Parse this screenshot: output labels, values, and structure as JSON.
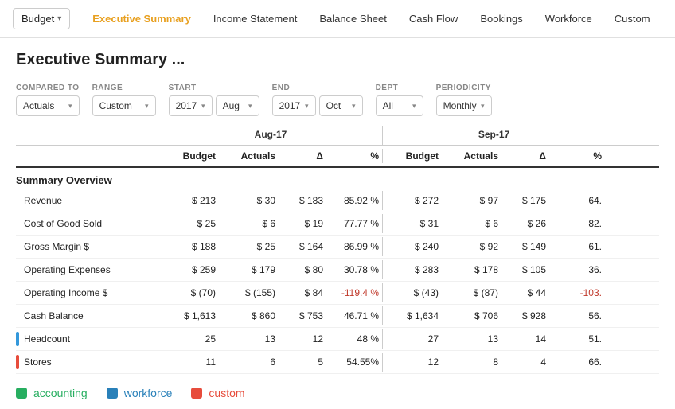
{
  "nav": {
    "dropdown_label": "Budget",
    "items": [
      {
        "label": "Executive Summary",
        "active": true
      },
      {
        "label": "Income Statement",
        "active": false
      },
      {
        "label": "Balance Sheet",
        "active": false
      },
      {
        "label": "Cash Flow",
        "active": false
      },
      {
        "label": "Bookings",
        "active": false
      },
      {
        "label": "Workforce",
        "active": false
      },
      {
        "label": "Custom",
        "active": false
      }
    ]
  },
  "page": {
    "title": "Executive Summary ..."
  },
  "filters": {
    "compared_to": {
      "label": "COMPARED TO",
      "value": "Actuals"
    },
    "range": {
      "label": "RANGE",
      "value": "Custom"
    },
    "start_year": {
      "label": "START",
      "value": "2017"
    },
    "start_month": {
      "value": "Aug"
    },
    "end_year": {
      "label": "END",
      "value": "2017"
    },
    "end_month": {
      "value": "Oct"
    },
    "dept": {
      "label": "DEPT",
      "value": "All"
    },
    "periodicity": {
      "label": "PERIODICITY",
      "value": "Monthly"
    }
  },
  "periods": [
    {
      "label": "Aug-17"
    },
    {
      "label": "Sep-17"
    }
  ],
  "col_headers": [
    "Budget",
    "Actuals",
    "Δ",
    "%"
  ],
  "section_title": "Summary Overview",
  "rows": [
    {
      "label": "Revenue",
      "indicator": null,
      "aug": {
        "budget": "$ 213",
        "actuals": "$ 30",
        "delta": "$ 183",
        "pct": "85.92 %"
      },
      "sep": {
        "budget": "$ 272",
        "actuals": "$ 97",
        "delta": "$ 175",
        "pct": "64."
      }
    },
    {
      "label": "Cost of Good Sold",
      "indicator": null,
      "aug": {
        "budget": "$ 25",
        "actuals": "$ 6",
        "delta": "$ 19",
        "pct": "77.77 %"
      },
      "sep": {
        "budget": "$ 31",
        "actuals": "$ 6",
        "delta": "$ 26",
        "pct": "82."
      }
    },
    {
      "label": "Gross Margin $",
      "indicator": null,
      "aug": {
        "budget": "$ 188",
        "actuals": "$ 25",
        "delta": "$ 164",
        "pct": "86.99 %"
      },
      "sep": {
        "budget": "$ 240",
        "actuals": "$ 92",
        "delta": "$ 149",
        "pct": "61."
      }
    },
    {
      "label": "Operating Expenses",
      "indicator": null,
      "aug": {
        "budget": "$ 259",
        "actuals": "$ 179",
        "delta": "$ 80",
        "pct": "30.78 %"
      },
      "sep": {
        "budget": "$ 283",
        "actuals": "$ 178",
        "delta": "$ 105",
        "pct": "36."
      }
    },
    {
      "label": "Operating Income $",
      "indicator": null,
      "aug": {
        "budget": "$ (70)",
        "actuals": "$ (155)",
        "delta": "$ 84",
        "pct": "-119.4 %",
        "pct_neg": true
      },
      "sep": {
        "budget": "$ (43)",
        "actuals": "$ (87)",
        "delta": "$ 44",
        "pct": "-103.",
        "pct_neg": true
      }
    },
    {
      "label": "Cash Balance",
      "indicator": null,
      "aug": {
        "budget": "$ 1,613",
        "actuals": "$ 860",
        "delta": "$ 753",
        "pct": "46.71 %"
      },
      "sep": {
        "budget": "$ 1,634",
        "actuals": "$ 706",
        "delta": "$ 928",
        "pct": "56."
      }
    },
    {
      "label": "Headcount",
      "indicator": "blue",
      "aug": {
        "budget": "25",
        "actuals": "13",
        "delta": "12",
        "pct": "48 %"
      },
      "sep": {
        "budget": "27",
        "actuals": "13",
        "delta": "14",
        "pct": "51."
      }
    },
    {
      "label": "Stores",
      "indicator": "orange",
      "aug": {
        "budget": "11",
        "actuals": "6",
        "delta": "5",
        "pct": "54.55%"
      },
      "sep": {
        "budget": "12",
        "actuals": "8",
        "delta": "4",
        "pct": "66."
      }
    }
  ],
  "legend": [
    {
      "label": "accounting",
      "color": "green"
    },
    {
      "label": "workforce",
      "color": "blue"
    },
    {
      "label": "custom",
      "color": "orange"
    }
  ]
}
